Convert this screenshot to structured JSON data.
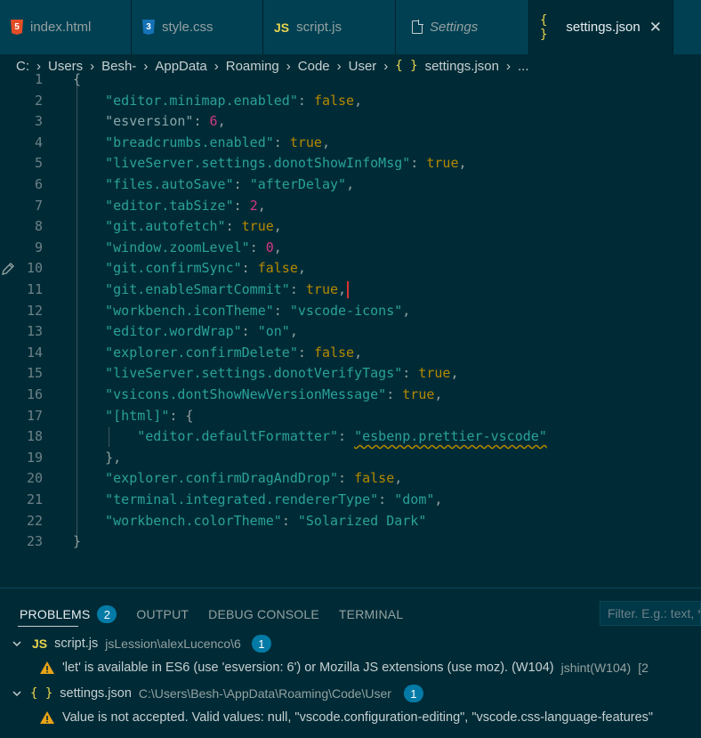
{
  "tabs": [
    {
      "label": "index.html",
      "icon": "html5-icon",
      "active": false
    },
    {
      "label": "style.css",
      "icon": "css3-icon",
      "active": false
    },
    {
      "label": "script.js",
      "icon": "js-icon",
      "active": false
    },
    {
      "label": "Settings",
      "icon": "file-icon",
      "active": false,
      "italic": true
    },
    {
      "label": "settings.json",
      "icon": "braces-icon",
      "active": true
    }
  ],
  "tab_icon_text": {
    "html": "5",
    "css": "3",
    "js": "JS",
    "braces": "{ }"
  },
  "close_glyph": "✕",
  "breadcrumb": [
    "C:",
    "Users",
    "Besh-",
    "AppData",
    "Roaming",
    "Code",
    "User",
    "settings.json",
    "..."
  ],
  "editor": {
    "lines": [
      {
        "n": "1",
        "parts": [
          [
            "p",
            "{"
          ]
        ]
      },
      {
        "n": "2",
        "parts": [
          [
            "p",
            "    "
          ],
          [
            "k",
            "\"editor.minimap.enabled\""
          ],
          [
            "p",
            ": "
          ],
          [
            "b",
            "false"
          ],
          [
            "p",
            ","
          ]
        ]
      },
      {
        "n": "3",
        "parts": [
          [
            "p",
            "    "
          ],
          [
            "kg",
            "\"esversion\""
          ],
          [
            "p",
            ": "
          ],
          [
            "n",
            "6"
          ],
          [
            "p",
            ","
          ]
        ]
      },
      {
        "n": "4",
        "parts": [
          [
            "p",
            "    "
          ],
          [
            "k",
            "\"breadcrumbs.enabled\""
          ],
          [
            "p",
            ": "
          ],
          [
            "b",
            "true"
          ],
          [
            "p",
            ","
          ]
        ]
      },
      {
        "n": "5",
        "parts": [
          [
            "p",
            "    "
          ],
          [
            "k",
            "\"liveServer.settings.donotShowInfoMsg\""
          ],
          [
            "p",
            ": "
          ],
          [
            "b",
            "true"
          ],
          [
            "p",
            ","
          ]
        ]
      },
      {
        "n": "6",
        "parts": [
          [
            "p",
            "    "
          ],
          [
            "k",
            "\"files.autoSave\""
          ],
          [
            "p",
            ": "
          ],
          [
            "s",
            "\"afterDelay\""
          ],
          [
            "p",
            ","
          ]
        ]
      },
      {
        "n": "7",
        "parts": [
          [
            "p",
            "    "
          ],
          [
            "k",
            "\"editor.tabSize\""
          ],
          [
            "p",
            ": "
          ],
          [
            "n",
            "2"
          ],
          [
            "p",
            ","
          ]
        ]
      },
      {
        "n": "8",
        "parts": [
          [
            "p",
            "    "
          ],
          [
            "k",
            "\"git.autofetch\""
          ],
          [
            "p",
            ": "
          ],
          [
            "b",
            "true"
          ],
          [
            "p",
            ","
          ]
        ]
      },
      {
        "n": "9",
        "parts": [
          [
            "p",
            "    "
          ],
          [
            "k",
            "\"window.zoomLevel\""
          ],
          [
            "p",
            ": "
          ],
          [
            "n",
            "0"
          ],
          [
            "p",
            ","
          ]
        ]
      },
      {
        "n": "10",
        "parts": [
          [
            "p",
            "    "
          ],
          [
            "k",
            "\"git.confirmSync\""
          ],
          [
            "p",
            ": "
          ],
          [
            "b",
            "false"
          ],
          [
            "p",
            ","
          ]
        ]
      },
      {
        "n": "11",
        "parts": [
          [
            "p",
            "    "
          ],
          [
            "k",
            "\"git.enableSmartCommit\""
          ],
          [
            "p",
            ": "
          ],
          [
            "b",
            "true"
          ],
          [
            "p",
            ","
          ],
          [
            "cursor",
            ""
          ]
        ]
      },
      {
        "n": "12",
        "parts": [
          [
            "p",
            "    "
          ],
          [
            "k",
            "\"workbench.iconTheme\""
          ],
          [
            "p",
            ": "
          ],
          [
            "s",
            "\"vscode-icons\""
          ],
          [
            "p",
            ","
          ]
        ]
      },
      {
        "n": "13",
        "parts": [
          [
            "p",
            "    "
          ],
          [
            "k",
            "\"editor.wordWrap\""
          ],
          [
            "p",
            ": "
          ],
          [
            "s",
            "\"on\""
          ],
          [
            "p",
            ","
          ]
        ]
      },
      {
        "n": "14",
        "parts": [
          [
            "p",
            "    "
          ],
          [
            "k",
            "\"explorer.confirmDelete\""
          ],
          [
            "p",
            ": "
          ],
          [
            "b",
            "false"
          ],
          [
            "p",
            ","
          ]
        ]
      },
      {
        "n": "15",
        "parts": [
          [
            "p",
            "    "
          ],
          [
            "k",
            "\"liveServer.settings.donotVerifyTags\""
          ],
          [
            "p",
            ": "
          ],
          [
            "b",
            "true"
          ],
          [
            "p",
            ","
          ]
        ]
      },
      {
        "n": "16",
        "parts": [
          [
            "p",
            "    "
          ],
          [
            "k",
            "\"vsicons.dontShowNewVersionMessage\""
          ],
          [
            "p",
            ": "
          ],
          [
            "b",
            "true"
          ],
          [
            "p",
            ","
          ]
        ]
      },
      {
        "n": "17",
        "parts": [
          [
            "p",
            "    "
          ],
          [
            "k",
            "\"[html]\""
          ],
          [
            "p",
            ": {"
          ]
        ]
      },
      {
        "n": "18",
        "parts": [
          [
            "p",
            "        "
          ],
          [
            "k",
            "\"editor.defaultFormatter\""
          ],
          [
            "p",
            ": "
          ],
          [
            "sq",
            "\"esbenp.prettier-vscode\""
          ]
        ]
      },
      {
        "n": "19",
        "parts": [
          [
            "p",
            "    },"
          ]
        ]
      },
      {
        "n": "20",
        "parts": [
          [
            "p",
            "    "
          ],
          [
            "k",
            "\"explorer.confirmDragAndDrop\""
          ],
          [
            "p",
            ": "
          ],
          [
            "b",
            "false"
          ],
          [
            "p",
            ","
          ]
        ]
      },
      {
        "n": "21",
        "parts": [
          [
            "p",
            "    "
          ],
          [
            "k",
            "\"terminal.integrated.rendererType\""
          ],
          [
            "p",
            ": "
          ],
          [
            "s",
            "\"dom\""
          ],
          [
            "p",
            ","
          ]
        ]
      },
      {
        "n": "22",
        "parts": [
          [
            "p",
            "    "
          ],
          [
            "k",
            "\"workbench.colorTheme\""
          ],
          [
            "p",
            ": "
          ],
          [
            "s",
            "\"Solarized Dark\""
          ]
        ]
      },
      {
        "n": "23",
        "parts": [
          [
            "p",
            "}"
          ]
        ]
      }
    ]
  },
  "panel": {
    "tabs": [
      {
        "label": "PROBLEMS",
        "active": true,
        "badge": "2"
      },
      {
        "label": "OUTPUT",
        "active": false
      },
      {
        "label": "DEBUG CONSOLE",
        "active": false
      },
      {
        "label": "TERMINAL",
        "active": false
      }
    ],
    "filter_placeholder": "Filter. E.g.: text, **/*.ts, !**/node_modules/**",
    "problems": [
      {
        "file": "script.js",
        "icon_text": "JS",
        "path": "jsLession\\alexLucenco\\6",
        "count": "1",
        "message": "'let' is available in ES6 (use 'esversion: 6') or Mozilla JS extensions (use moz). (W104)",
        "source": "jshint(W104)",
        "position": "[2"
      },
      {
        "file": "settings.json",
        "icon_text": "{ }",
        "path": "C:\\Users\\Besh-\\AppData\\Roaming\\Code\\User",
        "count": "1",
        "message": "Value is not accepted. Valid values: null, \"vscode.configuration-editing\", \"vscode.css-language-features\"",
        "source": "",
        "position": ""
      }
    ]
  },
  "colors": {
    "background": "#002b36",
    "tabbar": "#004052",
    "key": "#2aa198",
    "boolean": "#b58900",
    "number": "#d33682",
    "warning": "#e8a317",
    "badge": "#047aa6"
  }
}
